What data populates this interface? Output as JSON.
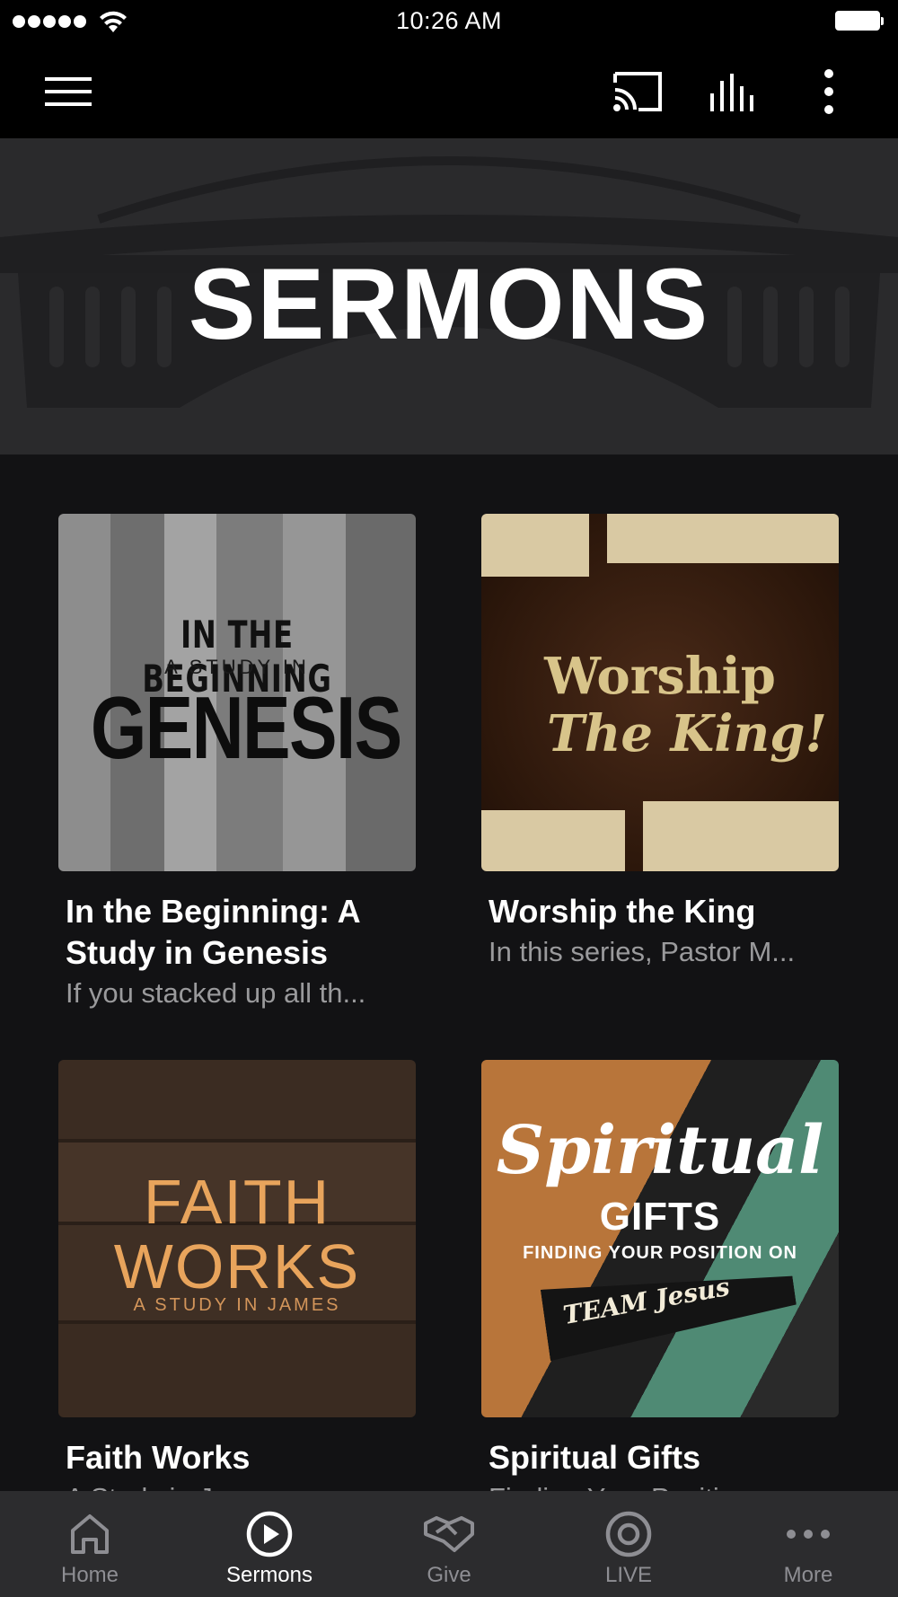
{
  "status_bar": {
    "time": "10:26 AM",
    "signal_icon": "signal-dots-icon",
    "wifi_icon": "wifi-icon",
    "battery_icon": "battery-icon"
  },
  "app_bar": {
    "menu_icon": "hamburger-menu-icon",
    "cast_icon": "cast-icon",
    "audio_icon": "audio-bars-icon",
    "more_icon": "vertical-dots-icon"
  },
  "hero": {
    "title": "SERMONS"
  },
  "series": [
    {
      "title": "In the Beginning: A Study in Genesis",
      "description": "If you stacked up all th...",
      "art": {
        "line1": "IN THE BEGINNING",
        "line2": "A STUDY IN",
        "line3": "GENESIS"
      }
    },
    {
      "title": "Worship the King",
      "description": "In this series, Pastor M...",
      "art": {
        "line1": "Worship",
        "line2": "The King!"
      }
    },
    {
      "title": "Faith Works",
      "description": "A Study in J...",
      "art": {
        "line1": "FAITH",
        "line2": "WORKS",
        "line3": "A STUDY IN JAMES"
      }
    },
    {
      "title": "Spiritual Gifts",
      "description": "Finding Your Positi...",
      "art": {
        "line1": "Spiritual",
        "line2": "GIFTS",
        "line3": "FINDING YOUR POSITION ON",
        "line4": "TEAM Jesus"
      }
    }
  ],
  "tabs": [
    {
      "label": "Home",
      "icon": "home-icon",
      "active": false
    },
    {
      "label": "Sermons",
      "icon": "play-circle-icon",
      "active": true
    },
    {
      "label": "Give",
      "icon": "handshake-icon",
      "active": false
    },
    {
      "label": "LIVE",
      "icon": "live-circle-icon",
      "active": false
    },
    {
      "label": "More",
      "icon": "more-dots-icon",
      "active": false
    }
  ],
  "colors": {
    "background": "#121214",
    "bar": "#000000",
    "hero": "#2a2a2c",
    "tab_bar": "#2c2c2e",
    "muted_text": "#9a9a9c",
    "inactive_tab": "#8e8e93"
  }
}
